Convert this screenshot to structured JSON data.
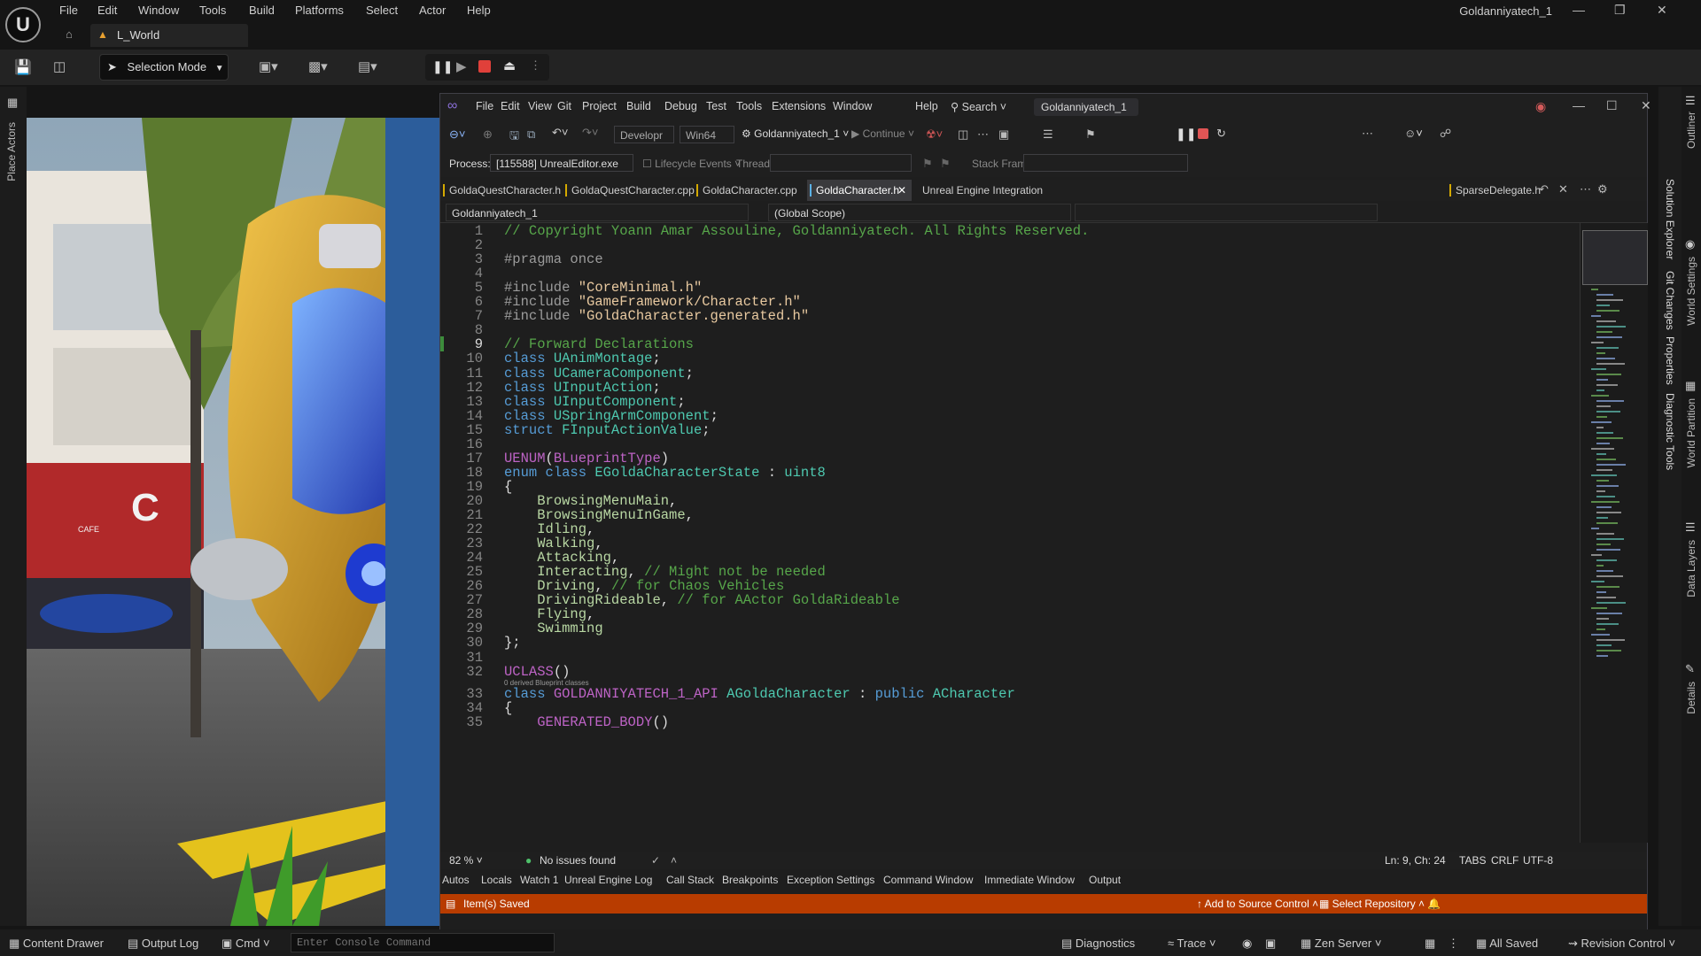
{
  "ue": {
    "menu": [
      "File",
      "Edit",
      "Window",
      "Tools",
      "Build",
      "Platforms",
      "Select",
      "Actor",
      "Help"
    ],
    "project_name": "Goldanniyatech_1",
    "level_tab": "L_World",
    "selection_mode": "Selection Mode",
    "left_panel": "Place Actors",
    "right_panels": [
      "Outliner",
      "World Settings",
      "World Partition",
      "Data Layers",
      "Details"
    ],
    "bottom": {
      "content_drawer": "Content Drawer",
      "output_log": "Output Log",
      "cmd": "Cmd",
      "console_placeholder": "Enter Console Command",
      "diagnostics": "Diagnostics",
      "trace": "Trace",
      "zen_server": "Zen Server",
      "all_saved": "All Saved",
      "revision_control": "Revision Control"
    },
    "scene_sign": "C",
    "scene_cafe": "CAFE"
  },
  "vs": {
    "menu": [
      "File",
      "Edit",
      "View",
      "Git",
      "Project",
      "Build",
      "Debug",
      "Test",
      "Tools",
      "Extensions",
      "Window",
      "Help"
    ],
    "search": "Search",
    "solution": "Goldanniyatech_1",
    "toolbar": {
      "config": "Developr",
      "platform": "Win64",
      "target": "Goldanniyatech_1",
      "continue": "Continue"
    },
    "process_label": "Process:",
    "process_value": "[115588] UnrealEditor.exe",
    "lifecycle": "Lifecycle Events",
    "thread_label": "Thread:",
    "stackframe_label": "Stack Frame:",
    "tabs": [
      "GoldaQuestCharacter.h",
      "GoldaQuestCharacter.cpp",
      "GoldaCharacter.cpp",
      "GoldaCharacter.h",
      "Unreal Engine Integration Configuration"
    ],
    "pinned_tab": "SparseDelegate.h",
    "nav_project": "Goldanniyatech_1",
    "nav_scope": "(Global Scope)",
    "codelens": "0 derived Blueprint classes",
    "zoom": "82 %",
    "issues": "No issues found",
    "position": "Ln: 9, Ch: 24",
    "tabs_mode": "TABS",
    "eol": "CRLF",
    "encoding": "UTF-8",
    "bottom_tabs": [
      "Autos",
      "Locals",
      "Watch 1",
      "Unreal Engine Log",
      "Call Stack",
      "Breakpoints",
      "Exception Settings",
      "Command Window",
      "Immediate Window",
      "Output"
    ],
    "status_msg": "Item(s) Saved",
    "add_source": "Add to Source Control",
    "select_repo": "Select Repository",
    "right_panels": [
      "Solution Explorer",
      "Git Changes",
      "Properties",
      "Diagnostic Tools"
    ]
  },
  "code_lines": [
    "// Copyright Yoann Amar Assouline, Goldanniyatech. All Rights Reserved.",
    "",
    "#pragma once",
    "",
    "#include \"CoreMinimal.h\"",
    "#include \"GameFramework/Character.h\"",
    "#include \"GoldaCharacter.generated.h\"",
    "",
    "// Forward Declarations",
    "class UAnimMontage;",
    "class UCameraComponent;",
    "class UInputAction;",
    "class UInputComponent;",
    "class USpringArmComponent;",
    "struct FInputActionValue;",
    "",
    "UENUM(BLueprintType)",
    "enum class EGoldaCharacterState : uint8",
    "{",
    "    BrowsingMenuMain,",
    "    BrowsingMenuInGame,",
    "    Idling,",
    "    Walking,",
    "    Attacking,",
    "    Interacting, // Might not be needed",
    "    Driving, // for Chaos Vehicles",
    "    DrivingRideable, // for AActor GoldaRideable",
    "    Flying,",
    "    Swimming",
    "};",
    "",
    "UCLASS()",
    "class GOLDANNIYATECH_1_API AGoldaCharacter : public ACharacter",
    "{",
    "    GENERATED_BODY()"
  ]
}
